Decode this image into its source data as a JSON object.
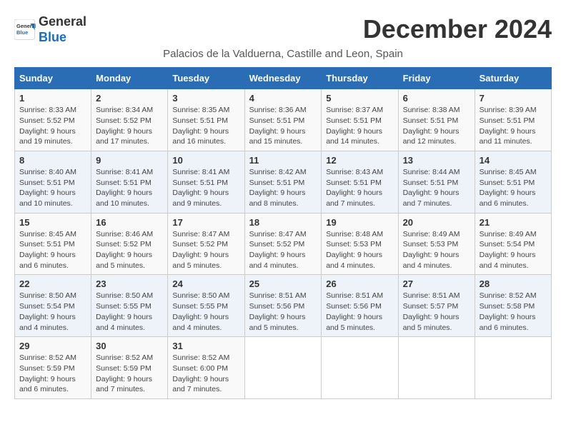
{
  "header": {
    "logo_general": "General",
    "logo_blue": "Blue",
    "month_title": "December 2024",
    "location": "Palacios de la Valduerna, Castille and Leon, Spain"
  },
  "days_of_week": [
    "Sunday",
    "Monday",
    "Tuesday",
    "Wednesday",
    "Thursday",
    "Friday",
    "Saturday"
  ],
  "weeks": [
    [
      {
        "day": "1",
        "sunrise": "8:33 AM",
        "sunset": "5:52 PM",
        "daylight": "9 hours and 19 minutes."
      },
      {
        "day": "2",
        "sunrise": "8:34 AM",
        "sunset": "5:52 PM",
        "daylight": "9 hours and 17 minutes."
      },
      {
        "day": "3",
        "sunrise": "8:35 AM",
        "sunset": "5:51 PM",
        "daylight": "9 hours and 16 minutes."
      },
      {
        "day": "4",
        "sunrise": "8:36 AM",
        "sunset": "5:51 PM",
        "daylight": "9 hours and 15 minutes."
      },
      {
        "day": "5",
        "sunrise": "8:37 AM",
        "sunset": "5:51 PM",
        "daylight": "9 hours and 14 minutes."
      },
      {
        "day": "6",
        "sunrise": "8:38 AM",
        "sunset": "5:51 PM",
        "daylight": "9 hours and 12 minutes."
      },
      {
        "day": "7",
        "sunrise": "8:39 AM",
        "sunset": "5:51 PM",
        "daylight": "9 hours and 11 minutes."
      }
    ],
    [
      {
        "day": "8",
        "sunrise": "8:40 AM",
        "sunset": "5:51 PM",
        "daylight": "9 hours and 10 minutes."
      },
      {
        "day": "9",
        "sunrise": "8:41 AM",
        "sunset": "5:51 PM",
        "daylight": "9 hours and 10 minutes."
      },
      {
        "day": "10",
        "sunrise": "8:41 AM",
        "sunset": "5:51 PM",
        "daylight": "9 hours and 9 minutes."
      },
      {
        "day": "11",
        "sunrise": "8:42 AM",
        "sunset": "5:51 PM",
        "daylight": "9 hours and 8 minutes."
      },
      {
        "day": "12",
        "sunrise": "8:43 AM",
        "sunset": "5:51 PM",
        "daylight": "9 hours and 7 minutes."
      },
      {
        "day": "13",
        "sunrise": "8:44 AM",
        "sunset": "5:51 PM",
        "daylight": "9 hours and 7 minutes."
      },
      {
        "day": "14",
        "sunrise": "8:45 AM",
        "sunset": "5:51 PM",
        "daylight": "9 hours and 6 minutes."
      }
    ],
    [
      {
        "day": "15",
        "sunrise": "8:45 AM",
        "sunset": "5:51 PM",
        "daylight": "9 hours and 6 minutes."
      },
      {
        "day": "16",
        "sunrise": "8:46 AM",
        "sunset": "5:52 PM",
        "daylight": "9 hours and 5 minutes."
      },
      {
        "day": "17",
        "sunrise": "8:47 AM",
        "sunset": "5:52 PM",
        "daylight": "9 hours and 5 minutes."
      },
      {
        "day": "18",
        "sunrise": "8:47 AM",
        "sunset": "5:52 PM",
        "daylight": "9 hours and 4 minutes."
      },
      {
        "day": "19",
        "sunrise": "8:48 AM",
        "sunset": "5:53 PM",
        "daylight": "9 hours and 4 minutes."
      },
      {
        "day": "20",
        "sunrise": "8:49 AM",
        "sunset": "5:53 PM",
        "daylight": "9 hours and 4 minutes."
      },
      {
        "day": "21",
        "sunrise": "8:49 AM",
        "sunset": "5:54 PM",
        "daylight": "9 hours and 4 minutes."
      }
    ],
    [
      {
        "day": "22",
        "sunrise": "8:50 AM",
        "sunset": "5:54 PM",
        "daylight": "9 hours and 4 minutes."
      },
      {
        "day": "23",
        "sunrise": "8:50 AM",
        "sunset": "5:55 PM",
        "daylight": "9 hours and 4 minutes."
      },
      {
        "day": "24",
        "sunrise": "8:50 AM",
        "sunset": "5:55 PM",
        "daylight": "9 hours and 4 minutes."
      },
      {
        "day": "25",
        "sunrise": "8:51 AM",
        "sunset": "5:56 PM",
        "daylight": "9 hours and 5 minutes."
      },
      {
        "day": "26",
        "sunrise": "8:51 AM",
        "sunset": "5:56 PM",
        "daylight": "9 hours and 5 minutes."
      },
      {
        "day": "27",
        "sunrise": "8:51 AM",
        "sunset": "5:57 PM",
        "daylight": "9 hours and 5 minutes."
      },
      {
        "day": "28",
        "sunrise": "8:52 AM",
        "sunset": "5:58 PM",
        "daylight": "9 hours and 6 minutes."
      }
    ],
    [
      {
        "day": "29",
        "sunrise": "8:52 AM",
        "sunset": "5:59 PM",
        "daylight": "9 hours and 6 minutes."
      },
      {
        "day": "30",
        "sunrise": "8:52 AM",
        "sunset": "5:59 PM",
        "daylight": "9 hours and 7 minutes."
      },
      {
        "day": "31",
        "sunrise": "8:52 AM",
        "sunset": "6:00 PM",
        "daylight": "9 hours and 7 minutes."
      },
      null,
      null,
      null,
      null
    ]
  ]
}
